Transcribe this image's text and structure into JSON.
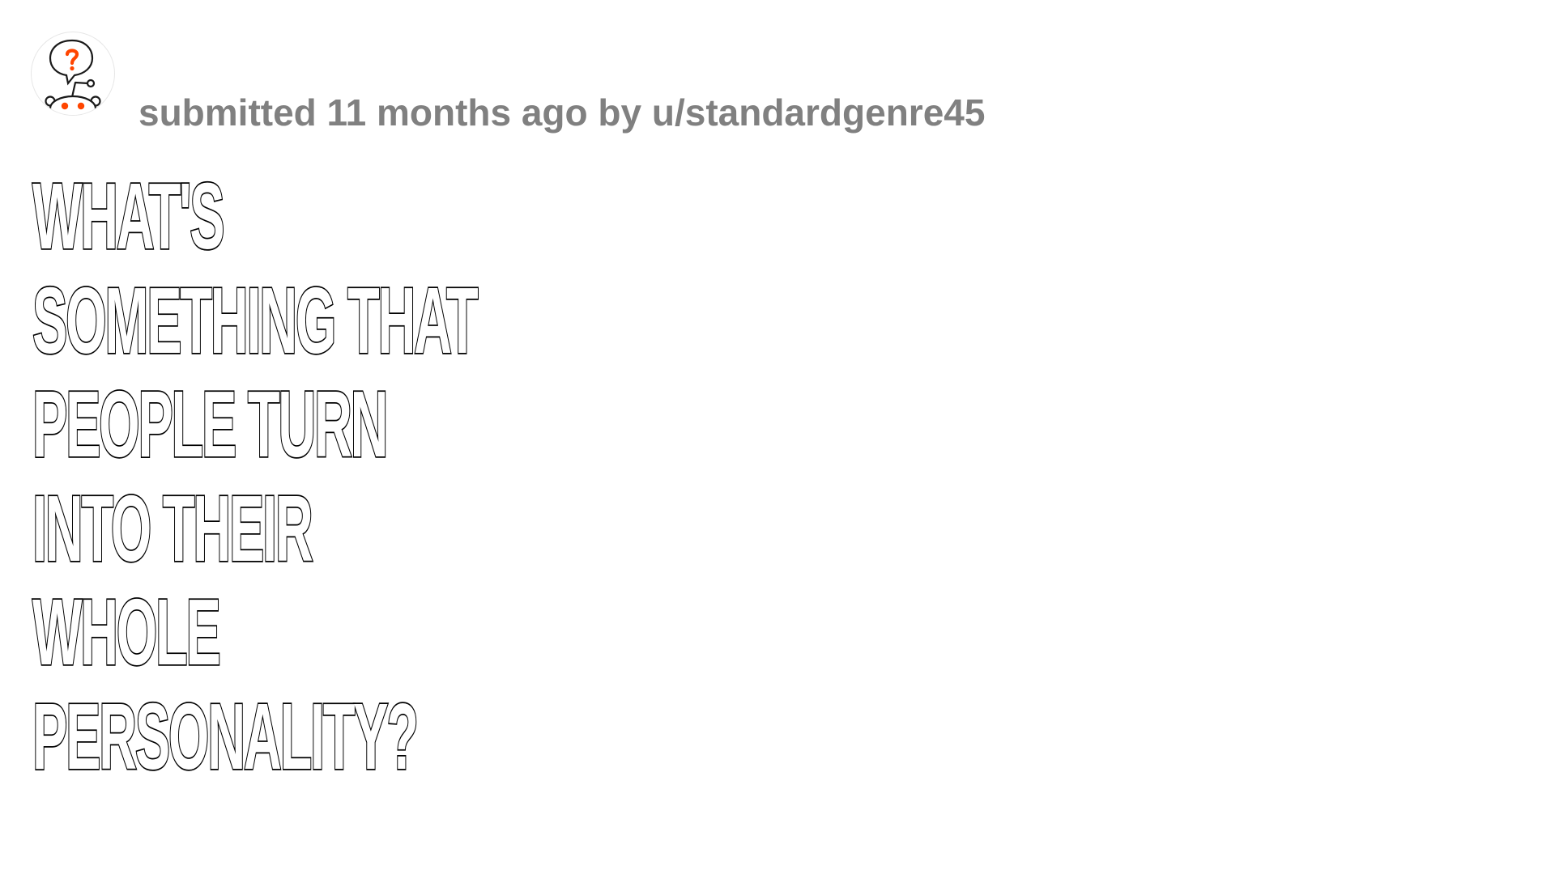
{
  "post": {
    "avatar_icon": "askreddit-snoo-question-icon",
    "submitted_text": "submitted 11 months ago by u/standardgenre45",
    "title_lines": [
      "What's",
      "something that",
      "people turn",
      "into their",
      "whole",
      "personality?"
    ]
  },
  "colors": {
    "background": "#ffffff",
    "meta_text": "#808080",
    "title_outline": "#000000",
    "title_fill": "#ffffff",
    "accent": "#ff4500"
  }
}
